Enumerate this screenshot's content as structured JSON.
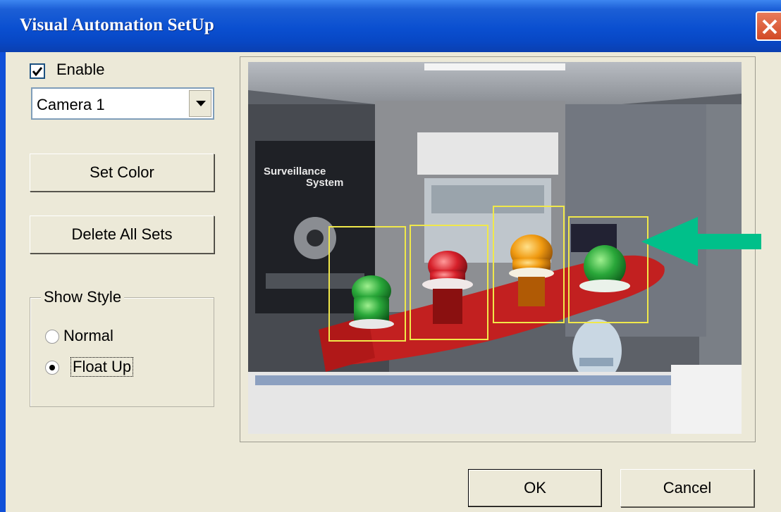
{
  "window": {
    "title": "Visual Automation SetUp"
  },
  "controls": {
    "enable_label": "Enable",
    "enable_checked": true,
    "camera_select_value": "Camera 1",
    "set_color_label": "Set Color",
    "delete_all_label": "Delete All Sets",
    "show_style_legend": "Show Style",
    "show_style_options": [
      "Normal",
      "Float Up"
    ],
    "show_style_selected": "Float Up"
  },
  "preview": {
    "poster_line1": "Surveillance",
    "poster_line2": "System",
    "detected_objects": [
      "green-light",
      "red-light",
      "orange-light",
      "green-light"
    ],
    "box_color": "#f0e84a"
  },
  "annotation": {
    "arrow_color": "#00c08a"
  },
  "footer": {
    "ok_label": "OK",
    "cancel_label": "Cancel"
  },
  "colors": {
    "titlebar": "#0a4fd0",
    "dialog_bg": "#ece9d8"
  }
}
